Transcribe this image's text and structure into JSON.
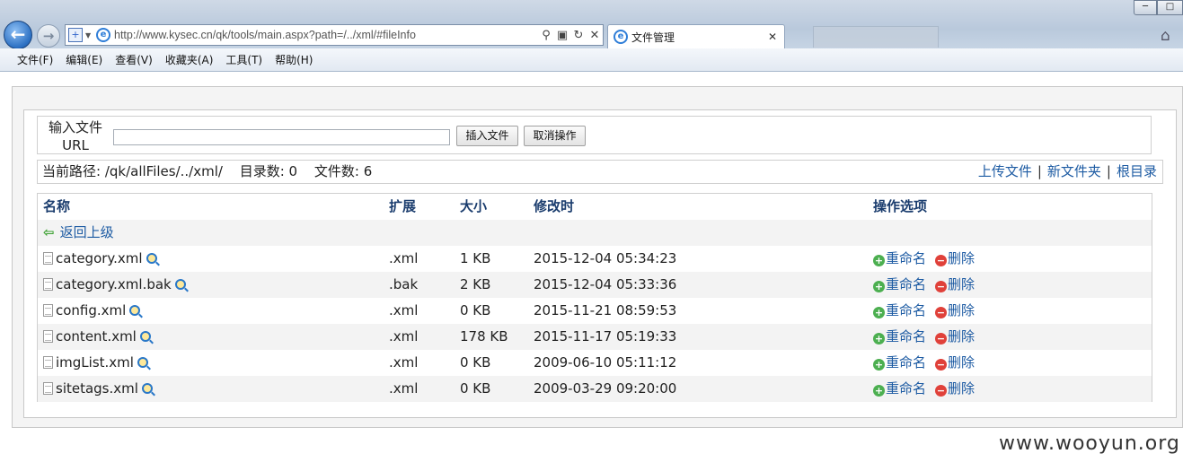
{
  "browser": {
    "url": "http://www.kysec.cn/qk/tools/main.aspx?path=/../xml/#fileInfo",
    "tab_title": "文件管理",
    "menu": [
      "文件(F)",
      "编辑(E)",
      "查看(V)",
      "收藏夹(A)",
      "工具(T)",
      "帮助(H)"
    ]
  },
  "upload": {
    "label": "输入文件URL",
    "input_value": "",
    "insert_button": "插入文件",
    "cancel_button": "取消操作"
  },
  "path_bar": {
    "current_path": "当前路径: /qk/allFiles/../xml/",
    "dir_count": "目录数: 0",
    "file_count": "文件数: 6",
    "links": [
      "上传文件",
      "新文件夹",
      "根目录"
    ]
  },
  "table": {
    "headers": [
      "名称",
      "扩展",
      "大小",
      "修改时",
      "操作选项"
    ],
    "back_label": "返回上级",
    "rename_label": "重命名",
    "delete_label": "删除",
    "rows": [
      {
        "name": "category.xml",
        "ext": ".xml",
        "size": "1 KB",
        "modified": "2015-12-04 05:34:23"
      },
      {
        "name": "category.xml.bak",
        "ext": ".bak",
        "size": "2 KB",
        "modified": "2015-12-04 05:33:36"
      },
      {
        "name": "config.xml",
        "ext": ".xml",
        "size": "0 KB",
        "modified": "2015-11-21 08:59:53"
      },
      {
        "name": "content.xml",
        "ext": ".xml",
        "size": "178 KB",
        "modified": "2015-11-17 05:19:33"
      },
      {
        "name": "imgList.xml",
        "ext": ".xml",
        "size": "0 KB",
        "modified": "2009-06-10 05:11:12"
      },
      {
        "name": "sitetags.xml",
        "ext": ".xml",
        "size": "0 KB",
        "modified": "2009-03-29 09:20:00"
      }
    ]
  },
  "watermark": "www.wooyun.org"
}
